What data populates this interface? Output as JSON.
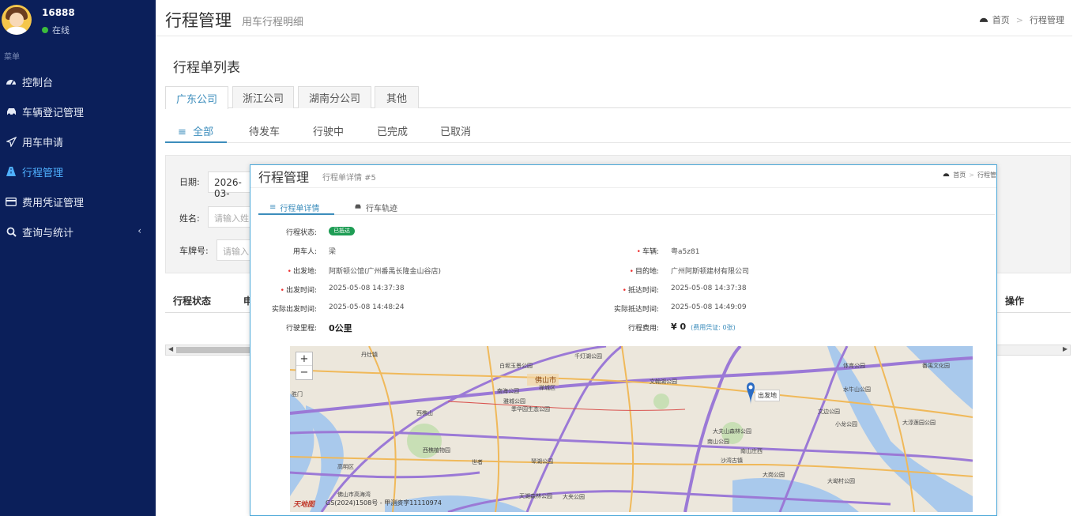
{
  "user": {
    "name": "16888",
    "status": "在线"
  },
  "menu_header": "菜单",
  "sidebar": {
    "items": [
      {
        "label": "控制台"
      },
      {
        "label": "车辆登记管理"
      },
      {
        "label": "用车申请"
      },
      {
        "label": "行程管理"
      },
      {
        "label": "费用凭证管理"
      },
      {
        "label": "查询与统计",
        "chevron": "‹"
      }
    ]
  },
  "page": {
    "title": "行程管理",
    "subtitle": "用车行程明细"
  },
  "breadcrumb": {
    "home": "首页",
    "sep": ">",
    "current": "行程管理"
  },
  "list_title": "行程单列表",
  "company_tabs": [
    "广东公司",
    "浙江公司",
    "湖南分公司",
    "其他"
  ],
  "status_tabs": [
    "全部",
    "待发车",
    "行驶中",
    "已完成",
    "已取消"
  ],
  "filter": {
    "date_label": "日期:",
    "date_value": "2026-03-",
    "name_label": "姓名:",
    "name_placeholder": "请输入姓",
    "plate_label": "车牌号:",
    "plate_placeholder": "请输入"
  },
  "table": {
    "col_status": "行程状态",
    "col_partial": "申",
    "col_action": "操作"
  },
  "modal": {
    "title": "行程管理",
    "subtitle": "行程单详情 #5",
    "breadcrumb": {
      "home": "首页",
      "sep": ">",
      "current": "行程管"
    },
    "tabs": [
      "行程单详情",
      "行车轨迹"
    ],
    "fields": {
      "status_label": "行程状态:",
      "status_value": "已抵达",
      "user_label": "用车人:",
      "user_value": "梁",
      "vehicle_label": "车辆:",
      "vehicle_value": "粤a5z81",
      "origin_label": "出发地:",
      "origin_value": "阿斯顿公馆(广州番禺长隆金山谷店)",
      "dest_label": "目的地:",
      "dest_value": "广州阿斯顿建材有限公司",
      "depart_label": "出发时间:",
      "depart_value": "2025-05-08 14:37:38",
      "arrive_label": "抵达时间:",
      "arrive_value": "2025-05-08 14:37:38",
      "actual_depart_label": "实际出发时间:",
      "actual_depart_value": "2025-05-08 14:48:24",
      "actual_arrive_label": "实际抵达时间:",
      "actual_arrive_value": "2025-05-08 14:49:09",
      "mileage_label": "行驶里程:",
      "mileage_value": "0公里",
      "cost_label": "行程费用:",
      "cost_value": "¥ 0",
      "cost_note": "(费用凭证: 0张)"
    },
    "map": {
      "zoom_in": "+",
      "zoom_out": "−",
      "pin_label": "出发地",
      "footer": "GS(2024)1508号 - 甲测资字11110974",
      "logo": "天地图",
      "places": [
        "丹灶镇",
        "白坭玉景公园",
        "千灯湖公园",
        "佛山市",
        "禅城区",
        "南海公园",
        "文翰湖公园",
        "体育公园",
        "番禺文化园",
        "雅城公园",
        "水牛山公园",
        "季华园生态公园",
        "西樵山",
        "大夫山森林公园",
        "文边公园",
        "小龙公园",
        "南山公园",
        "大淳莲园公园",
        "西樵植物园",
        "琴湖公园",
        "南山庄西",
        "沙湾古镇",
        "高明区",
        "大岗公园",
        "大坳村公园",
        "天湖森林公园",
        "大夹公园",
        "佛山市高海湾",
        "世者",
        "胜门"
      ]
    }
  }
}
